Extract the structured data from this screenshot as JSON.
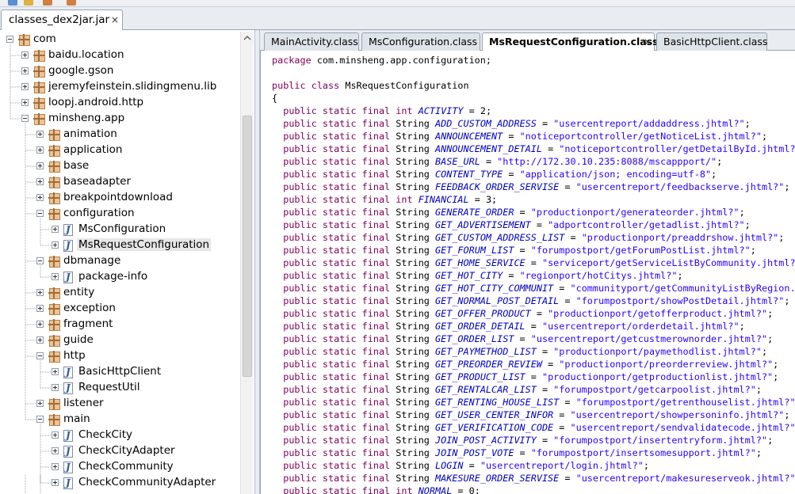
{
  "file_tab": {
    "label": "classes_dex2jar.jar",
    "close": "×"
  },
  "tree": [
    {
      "label": "com",
      "type": "package"
    },
    {
      "label": "baidu.location",
      "type": "package"
    },
    {
      "label": "google.gson",
      "type": "package"
    },
    {
      "label": "jeremyfeinstein.slidingmenu.lib",
      "type": "package"
    },
    {
      "label": "loopj.android.http",
      "type": "package"
    },
    {
      "label": "minsheng.app",
      "type": "package"
    },
    {
      "label": "animation",
      "type": "package"
    },
    {
      "label": "application",
      "type": "package"
    },
    {
      "label": "base",
      "type": "package"
    },
    {
      "label": "baseadapter",
      "type": "package"
    },
    {
      "label": "breakpointdownload",
      "type": "package"
    },
    {
      "label": "configuration",
      "type": "package"
    },
    {
      "label": "MsConfiguration",
      "type": "class"
    },
    {
      "label": "MsRequestConfiguration",
      "type": "class",
      "selected": true
    },
    {
      "label": "dbmanage",
      "type": "package"
    },
    {
      "label": "package-info",
      "type": "class"
    },
    {
      "label": "entity",
      "type": "package"
    },
    {
      "label": "exception",
      "type": "package"
    },
    {
      "label": "fragment",
      "type": "package"
    },
    {
      "label": "guide",
      "type": "package"
    },
    {
      "label": "http",
      "type": "package"
    },
    {
      "label": "BasicHttpClient",
      "type": "class"
    },
    {
      "label": "RequestUtil",
      "type": "class"
    },
    {
      "label": "listener",
      "type": "package"
    },
    {
      "label": "main",
      "type": "package"
    },
    {
      "label": "CheckCity",
      "type": "class"
    },
    {
      "label": "CheckCityAdapter",
      "type": "class"
    },
    {
      "label": "CheckCommunity",
      "type": "class"
    },
    {
      "label": "CheckCommunityAdapter",
      "type": "class"
    }
  ],
  "editor_tabs": [
    {
      "label": "MainActivity.class",
      "active": false
    },
    {
      "label": "MsConfiguration.class",
      "active": false
    },
    {
      "label": "MsRequestConfiguration.class",
      "active": true,
      "close": "×"
    },
    {
      "label": "BasicHttpClient.class",
      "active": false
    }
  ],
  "code": {
    "package_kw": "package",
    "package_name": " com.minsheng.app.configuration;",
    "class_kw": "public class",
    "class_name": " MsRequestConfiguration",
    "open_brace": "{",
    "field_prefix": "public static final",
    "fields": [
      {
        "type": "int",
        "name": "ACTIVITY",
        "value": "2"
      },
      {
        "type": "String",
        "name": "ADD_CUSTOM_ADDRESS",
        "value": "\"usercentreport/addaddress.jhtml?\""
      },
      {
        "type": "String",
        "name": "ANNOUNCEMENT",
        "value": "\"noticeportcontroller/getNoticeList.jhtml?\""
      },
      {
        "type": "String",
        "name": "ANNOUNCEMENT_DETAIL",
        "value": "\"noticeportcontroller/getDetailById.jhtml?\""
      },
      {
        "type": "String",
        "name": "BASE_URL",
        "value": "\"http://172.30.10.235:8088/mscappport/\""
      },
      {
        "type": "String",
        "name": "CONTENT_TYPE",
        "value": "\"application/json; encoding=utf-8\""
      },
      {
        "type": "String",
        "name": "FEEDBACK_ORDER_SERVISE",
        "value": "\"usercentreport/feedbackserve.jhtml?\""
      },
      {
        "type": "int",
        "name": "FINANCIAL",
        "value": "3"
      },
      {
        "type": "String",
        "name": "GENERATE_ORDER",
        "value": "\"productionport/generateorder.jhtml?\""
      },
      {
        "type": "String",
        "name": "GET_ADVERTISEMENT",
        "value": "\"adportcontroller/getadlist.jhtml?\""
      },
      {
        "type": "String",
        "name": "GET_CUSTOM_ADDRESS_LIST",
        "value": "\"productionport/preaddrshow.jhtml?\""
      },
      {
        "type": "String",
        "name": "GET_FORUM_LIST",
        "value": "\"forumpostport/getForumPostList.jhtml?\""
      },
      {
        "type": "String",
        "name": "GET_HOME_SERVICE",
        "value": "\"serviceport/getServiceListByCommunity.jhtml?\""
      },
      {
        "type": "String",
        "name": "GET_HOT_CITY",
        "value": "\"regionport/hotCitys.jhtml?\""
      },
      {
        "type": "String",
        "name": "GET_HOT_CITY_COMMUNIT",
        "value": "\"communityport/getCommunityListByRegion.jhtml?\""
      },
      {
        "type": "String",
        "name": "GET_NORMAL_POST_DETAIL",
        "value": "\"forumpostport/showPostDetail.jhtml?\""
      },
      {
        "type": "String",
        "name": "GET_OFFER_PRODUCT",
        "value": "\"productionport/getofferproduct.jhtml?\""
      },
      {
        "type": "String",
        "name": "GET_ORDER_DETAIL",
        "value": "\"usercentreport/orderdetail.jhtml?\""
      },
      {
        "type": "String",
        "name": "GET_ORDER_LIST",
        "value": "\"usercentreport/getcustmerownorder.jhtml?\""
      },
      {
        "type": "String",
        "name": "GET_PAYMETHOD_LIST",
        "value": "\"productionport/paymethodlist.jhtml?\""
      },
      {
        "type": "String",
        "name": "GET_PREORDER_REVIEW",
        "value": "\"productionport/preorderreview.jhtml?\""
      },
      {
        "type": "String",
        "name": "GET_PRODUCT_LIST",
        "value": "\"productionport/getproductionlist.jhtml?\""
      },
      {
        "type": "String",
        "name": "GET_RENTALCAR_LIST",
        "value": "\"forumpostport/getcarpoolist.jhtml?\""
      },
      {
        "type": "String",
        "name": "GET_RENTING_HOUSE_LIST",
        "value": "\"forumpostport/getrenthouselist.jhtml?\""
      },
      {
        "type": "String",
        "name": "GET_USER_CENTER_INFOR",
        "value": "\"usercentreport/showpersoninfo.jhtml?\""
      },
      {
        "type": "String",
        "name": "GET_VERIFICATION_CODE",
        "value": "\"usercentreport/sendvalidatecode.jhtml?\""
      },
      {
        "type": "String",
        "name": "JOIN_POST_ACTIVITY",
        "value": "\"forumpostport/insertentryform.jhtml?\""
      },
      {
        "type": "String",
        "name": "JOIN_POST_VOTE",
        "value": "\"forumpostport/insertsomesupport.jhtml?\""
      },
      {
        "type": "String",
        "name": "LOGIN",
        "value": "\"usercentreport/login.jhtml?\""
      },
      {
        "type": "String",
        "name": "MAKESURE_ORDER_SERVISE",
        "value": "\"usercentreport/makesureserveok.jhtml?\""
      },
      {
        "type": "int",
        "name": "NORMAL",
        "value": "0"
      }
    ]
  },
  "colors": {
    "keyword": "#7f0055",
    "field": "#0000c0",
    "string": "#2a00ff",
    "package_icon": "#e8c49a",
    "class_icon": "#2d5ba6"
  }
}
